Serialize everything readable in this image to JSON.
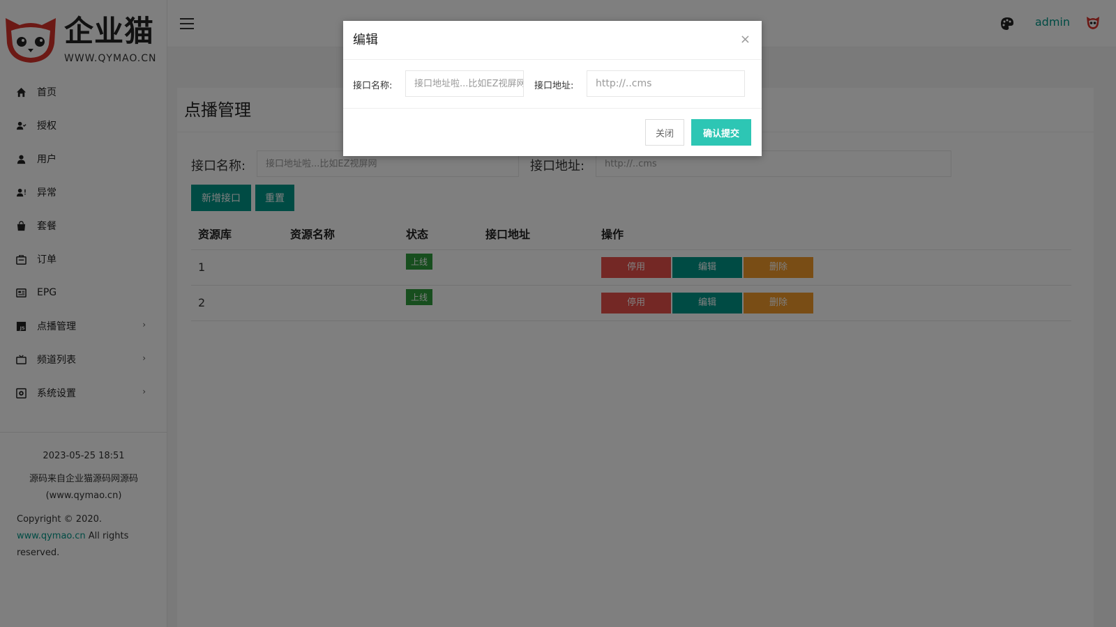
{
  "brand": {
    "name": "企业猫",
    "url": "WWW.QYMAO.CN"
  },
  "sidebar": {
    "items": [
      {
        "label": "首页",
        "icon": "home-icon"
      },
      {
        "label": "授权",
        "icon": "user-check-icon"
      },
      {
        "label": "用户",
        "icon": "user-icon"
      },
      {
        "label": "异常",
        "icon": "user-alert-icon"
      },
      {
        "label": "套餐",
        "icon": "bag-icon"
      },
      {
        "label": "订单",
        "icon": "order-icon"
      },
      {
        "label": "EPG",
        "icon": "epg-icon"
      },
      {
        "label": "点播管理",
        "icon": "js-icon",
        "arrow": "›"
      },
      {
        "label": "频道列表",
        "icon": "tv-icon",
        "arrow": "›"
      },
      {
        "label": "系统设置",
        "icon": "settings-icon",
        "arrow": "›"
      }
    ],
    "footer": {
      "datetime": "2023-05-25 18:51",
      "source_line1": "源码来自企业猫源码网源码",
      "source_line2": "(www.qymao.cn)",
      "copyright": "Copyright © 2020.",
      "link": "www.qymao.cn",
      "rights": " All rights reserved."
    }
  },
  "header": {
    "user": "admin"
  },
  "main": {
    "title": "点播管理",
    "search": {
      "name_label": "接口名称:",
      "name_placeholder": "接口地址啦...比如EZ视屏网",
      "url_label": "接口地址:",
      "url_placeholder": "http://..cms"
    },
    "buttons": {
      "add": "新增接口",
      "reset": "重置"
    },
    "table": {
      "columns": [
        "资源库",
        "资源名称",
        "状态",
        "接口地址",
        "操作"
      ],
      "rows": [
        {
          "id": "1",
          "name": "",
          "status": "上线",
          "url": ""
        },
        {
          "id": "2",
          "name": "",
          "status": "上线",
          "url": ""
        }
      ],
      "actions": {
        "disable": "停用",
        "edit": "编辑",
        "delete": "删除"
      }
    }
  },
  "modal": {
    "title": "编辑",
    "close_icon": "×",
    "name_label": "接口名称:",
    "name_placeholder": "接口地址啦...比如EZ视屏网",
    "url_label": "接口地址:",
    "url_placeholder": "http://..cms",
    "close_button": "关闭",
    "submit_button": "确认提交"
  },
  "colors": {
    "primary": "#009688",
    "submit": "#2dc6b4",
    "danger": "#e8514a",
    "warning": "#f39a2b",
    "badge": "#2e9c3c"
  }
}
